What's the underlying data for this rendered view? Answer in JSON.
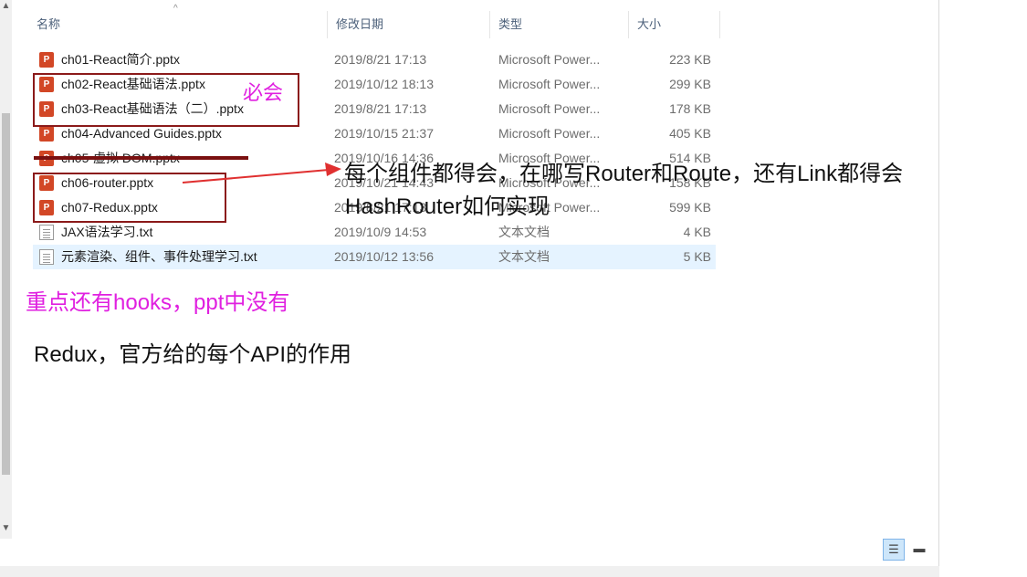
{
  "columns": {
    "name": "名称",
    "date": "修改日期",
    "type": "类型",
    "size": "大小"
  },
  "files": [
    {
      "name": "ch01-React简介.pptx",
      "date": "2019/8/21 17:13",
      "type": "Microsoft Power...",
      "size": "223 KB",
      "icon": "powerpoint-file-icon"
    },
    {
      "name": "ch02-React基础语法.pptx",
      "date": "2019/10/12 18:13",
      "type": "Microsoft Power...",
      "size": "299 KB",
      "icon": "powerpoint-file-icon"
    },
    {
      "name": "ch03-React基础语法（二）.pptx",
      "date": "2019/8/21 17:13",
      "type": "Microsoft Power...",
      "size": "178 KB",
      "icon": "powerpoint-file-icon"
    },
    {
      "name": "ch04-Advanced Guides.pptx",
      "date": "2019/10/15 21:37",
      "type": "Microsoft Power...",
      "size": "405 KB",
      "icon": "powerpoint-file-icon"
    },
    {
      "name": "ch05-虚拟 DOM.pptx",
      "date": "2019/10/16 14:36",
      "type": "Microsoft Power...",
      "size": "514 KB",
      "icon": "powerpoint-file-icon"
    },
    {
      "name": "ch06-router.pptx",
      "date": "2019/10/21 14:43",
      "type": "Microsoft Power...",
      "size": "158 KB",
      "icon": "powerpoint-file-icon"
    },
    {
      "name": "ch07-Redux.pptx",
      "date": "2019/8/21 17:13",
      "type": "Microsoft Power...",
      "size": "599 KB",
      "icon": "powerpoint-file-icon"
    },
    {
      "name": "JAX语法学习.txt",
      "date": "2019/10/9 14:53",
      "type": "文本文档",
      "size": "4 KB",
      "icon": "text-file-icon"
    },
    {
      "name": "元素渲染、组件、事件处理学习.txt",
      "date": "2019/10/12 13:56",
      "type": "文本文档",
      "size": "5 KB",
      "icon": "text-file-icon"
    }
  ],
  "annotations": {
    "must_know": "必会",
    "router_note": "每个组件都得会，在哪写Router和Route，还有Link都得会",
    "hashrouter_note": "HashRouter如何实现",
    "hooks_note": "重点还有hooks，ppt中没有",
    "redux_note": "Redux，官方给的每个API的作用"
  },
  "colors": {
    "annotation_pink": "#e020e0",
    "box_red": "#8b1a1a",
    "arrow_red": "#e03030",
    "selected_row": "#e5f3ff"
  },
  "selected_file_index": 8
}
